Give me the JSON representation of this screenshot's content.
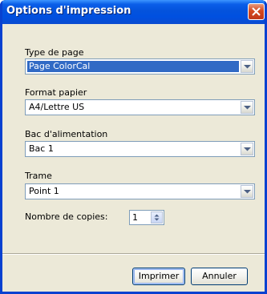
{
  "window": {
    "title": "Options d'impression"
  },
  "form": {
    "page_type": {
      "label": "Type de page",
      "value": "Page ColorCal"
    },
    "paper_format": {
      "label": "Format papier",
      "value": "A4/Lettre US"
    },
    "feed_tray": {
      "label": "Bac d'alimentation",
      "value": "Bac 1"
    },
    "screen": {
      "label": "Trame",
      "value": "Point 1"
    },
    "copies": {
      "label": "Nombre de copies:",
      "value": "1"
    }
  },
  "buttons": {
    "print": "Imprimer",
    "cancel": "Annuler"
  },
  "colors": {
    "titlebar": "#0453dc",
    "selection": "#316ac5",
    "dialog_background": "#ece9d8",
    "close_button": "#d5491f"
  },
  "icons": {
    "close": "close-icon",
    "dropdown": "chevron-down-icon",
    "spinner": "spin-up-down-icon"
  }
}
